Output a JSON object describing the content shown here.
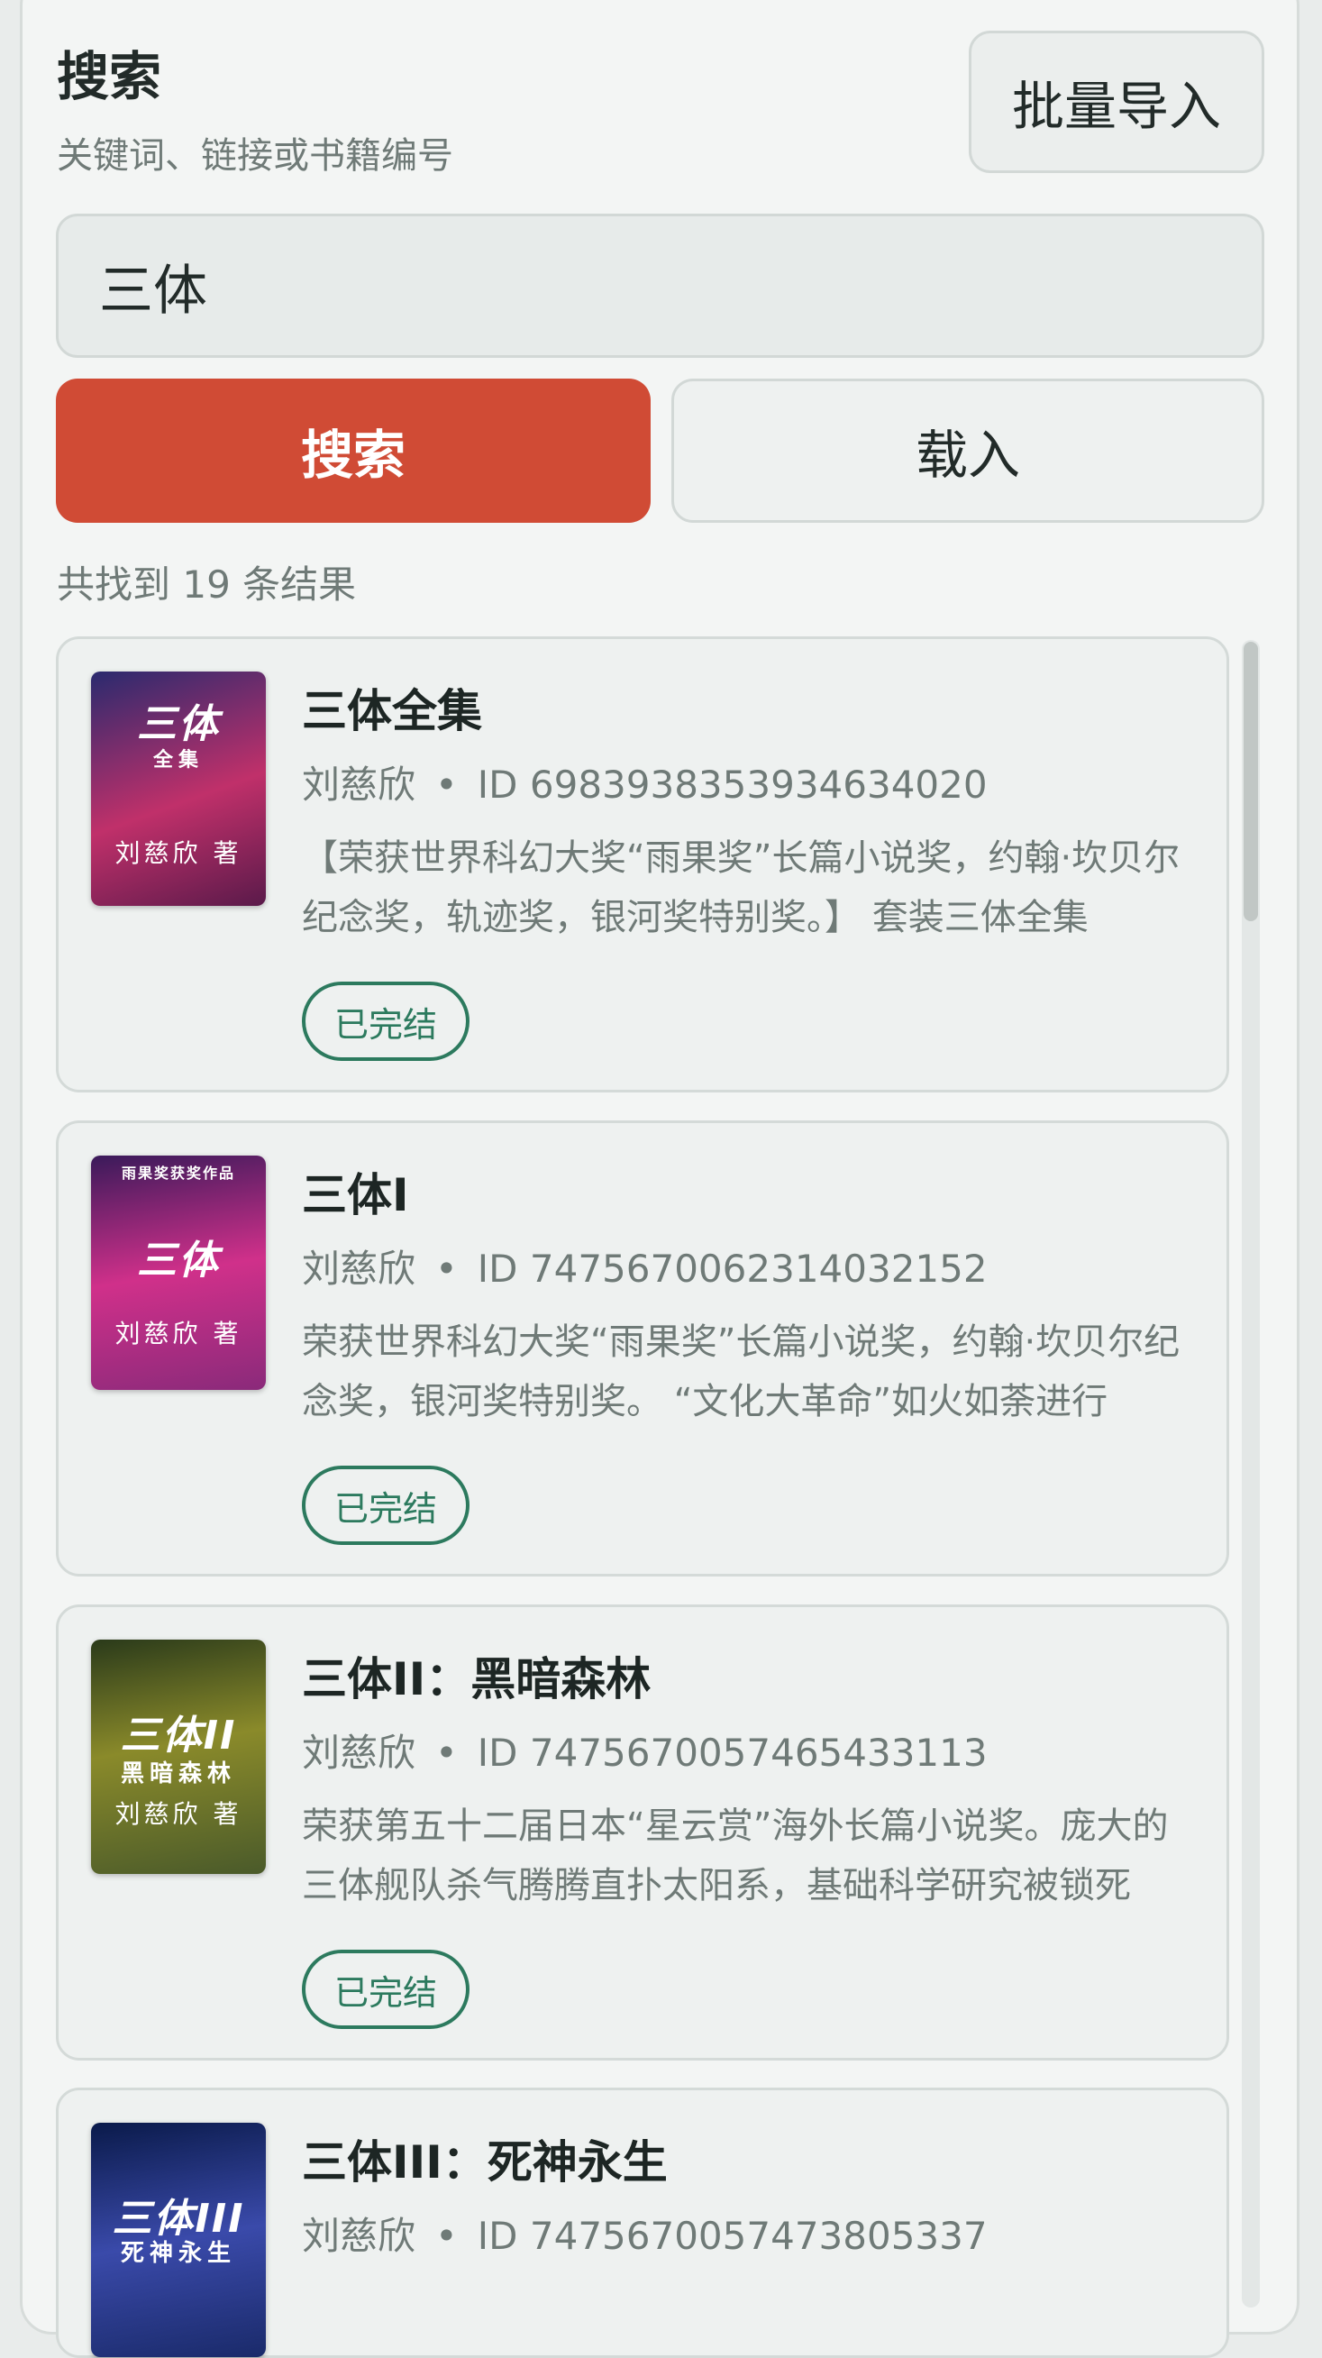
{
  "header": {
    "title": "搜索",
    "subtitle": "关键词、链接或书籍编号",
    "batch_import_label": "批量导入"
  },
  "search": {
    "value": "三体",
    "search_button": "搜索",
    "load_button": "载入"
  },
  "results": {
    "count_text": "共找到 19 条结果",
    "items": [
      {
        "title": "三体全集",
        "author": "刘慈欣",
        "separator": "•",
        "id": "ID 6983938353934634020",
        "description": "【荣获世界科幻大奖“雨果奖”长篇小说奖，约翰·坎贝尔纪念奖，轨迹奖，银河奖特别奖。】 套装三体全集",
        "status": "已完结",
        "cover": {
          "title": "三体",
          "sub": "全集",
          "author": "刘慈欣 著",
          "colors": [
            "#2a2a6e",
            "#c0306a",
            "#5a1a4a"
          ]
        }
      },
      {
        "title": "三体I",
        "author": "刘慈欣",
        "separator": "•",
        "id": "ID 7475670062314032152",
        "description": "荣获世界科幻大奖“雨果奖”长篇小说奖，约翰·坎贝尔纪念奖，银河奖特别奖。 “文化大革命”如火如荼进行",
        "status": "已完结",
        "cover": {
          "title": "三体",
          "sub": "雨果奖获奖作品",
          "author": "刘慈欣 著",
          "colors": [
            "#3a1a5a",
            "#d0308a",
            "#8a2a7a"
          ]
        }
      },
      {
        "title": "三体II：黑暗森林",
        "author": "刘慈欣",
        "separator": "•",
        "id": "ID 7475670057465433113",
        "description": "荣获第五十二届日本“星云赏”海外长篇小说奖。庞大的三体舰队杀气腾腾直扑太阳系，基础科学研究被锁死",
        "status": "已完结",
        "cover": {
          "title": "三体II",
          "sub": "黑暗森林",
          "author": "刘慈欣 著",
          "colors": [
            "#2a3a1a",
            "#8a8a2a",
            "#4a5a2a"
          ]
        }
      },
      {
        "title": "三体III：死神永生",
        "author": "刘慈欣",
        "separator": "•",
        "id": "ID 7475670057473805337",
        "description": "",
        "status": "",
        "cover": {
          "title": "三体III",
          "sub": "死神永生",
          "author": "",
          "colors": [
            "#0a1a4a",
            "#3a4aaa",
            "#1a2a6a"
          ]
        }
      }
    ]
  }
}
